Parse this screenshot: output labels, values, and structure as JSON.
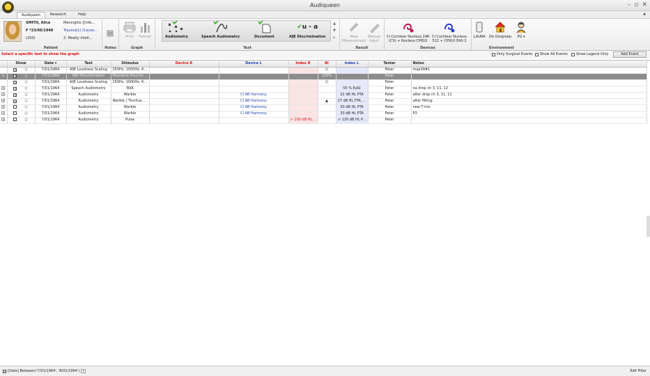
{
  "window": {
    "title": "Audiqueen"
  },
  "menu": {
    "tabs": [
      "Audiqueen",
      "Research",
      "Help"
    ]
  },
  "patient": {
    "name": "SMITH, Alice",
    "dob": "F *23/06/1948",
    "id": "(250)",
    "diag1": "Meningitis ([Infe...",
    "diag2": "Trauma(L) (Cause...",
    "diag3": "2: Mostly Intell...",
    "group_label": "Patient"
  },
  "notes": {
    "group_label": "Notes"
  },
  "graph": {
    "print": "Print",
    "format": "Format",
    "group_label": "Graph"
  },
  "test": {
    "group_label": "Text",
    "buttons": [
      "Audiometry",
      "Speech Audiometry",
      "Document",
      "A§E Discrimination"
    ],
    "glyph_ua": "u - a"
  },
  "result": {
    "new": "New",
    "measurement": "Measurement",
    "manual": "Manual",
    "input": "Input",
    "group_label": "Result"
  },
  "devices": {
    "group_label": "Devices",
    "dev1_line1": "CI Cochlear Nucleus 24R",
    "dev1_line2": "(CS) + Nucleus CP810",
    "dev2_line1": "CI Cochlear Nucleus",
    "dev2_line2": "512 + CP910 EAS 2"
  },
  "environment": {
    "group_label": "Environment",
    "items": [
      "LAURA",
      "De Oorgroep",
      "PG"
    ]
  },
  "hint": "Select a specific test to show the graph",
  "options": {
    "only_surgical": "Only Surgical Events",
    "show_all": "Show All Events",
    "legend_only": "Show Legend Only",
    "add_event": "Add Event"
  },
  "grid": {
    "headers": [
      "Show",
      "Date",
      "Test",
      "Stimulus",
      "Device R",
      "Device L",
      "Index R",
      "Bi",
      "Index L",
      "Tester",
      "Notes"
    ],
    "rows": [
      {
        "exp": "",
        "show": true,
        "date": "7/01/1964",
        "test": "A§E Loudness Scaling",
        "stimulus": "250Hz, 1000Hz, 40...",
        "devR": "",
        "devL": "",
        "idxR": "",
        "bi": "()",
        "idxL": "",
        "tester": "Peter",
        "notes": "map39#1",
        "selected": false
      },
      {
        "exp": "▸",
        "show": true,
        "date": "7/01/1964",
        "test": "A§E Discrimination",
        "stimulus": "Phoneme Discrimin...",
        "devR": "",
        "devL": "",
        "idxR": "",
        "bi": "100%",
        "idxL": "",
        "tester": "Peter",
        "notes": "",
        "selected": true
      },
      {
        "exp": "",
        "show": true,
        "date": "7/01/1964",
        "test": "A§E Loudness Scaling",
        "stimulus": "250Hz, 1000Hz, 40...",
        "devR": "",
        "devL": "",
        "idxR": "",
        "bi": "()",
        "idxL": "",
        "tester": "Peter",
        "notes": "",
        "selected": false
      },
      {
        "exp": "+",
        "show": true,
        "date": "7/01/1964",
        "test": "Speech Audiometry",
        "stimulus": "NVA",
        "devR": "",
        "devL": "",
        "idxR": "",
        "bi": "",
        "idxL": "55 % EaSI",
        "tester": "Peter",
        "notes": "na drop ch 3, 11, 12",
        "selected": false
      },
      {
        "exp": "+",
        "show": true,
        "date": "7/01/1964",
        "test": "Audiometry",
        "stimulus": "Warble",
        "devR": "",
        "devL": "CI AB Harmony",
        "idxR": "",
        "bi": "",
        "idxL": "22 dB HL PTA",
        "tester": "Peter",
        "notes": "after drop ch 3, 11, 12",
        "selected": false
      },
      {
        "exp": "+",
        "show": true,
        "date": "7/01/1964",
        "test": "Audiometry",
        "stimulus": "Warble | Tinnitus | ...",
        "devR": "",
        "devL": "CI AB Harmony",
        "idxR": "",
        "bi": "▲",
        "idxL": "27 dB HL PTA | +",
        "tester": "Peter",
        "notes": "after fitting",
        "selected": false
      },
      {
        "exp": "+",
        "show": false,
        "date": "7/01/1964",
        "test": "Audiometry",
        "stimulus": "Warble",
        "devR": "",
        "devL": "CI AB Harmony",
        "idxR": "",
        "bi": "",
        "idxL": "30 dB HL PTA",
        "tester": "Peter",
        "notes": "new T-mic",
        "selected": false
      },
      {
        "exp": "+",
        "show": false,
        "date": "7/01/1964",
        "test": "Audiometry",
        "stimulus": "Warble",
        "devR": "",
        "devL": "CI AB Harmony",
        "idxR": "",
        "bi": "",
        "idxL": "33 dB HL PTA",
        "tester": "Peter",
        "notes": "P3",
        "selected": false
      },
      {
        "exp": "+",
        "show": false,
        "date": "7/01/1964",
        "test": "Audiometry",
        "stimulus": "Pulse",
        "devR": "",
        "devL": "",
        "idxR": "> 100 dB HL P...",
        "bi": "",
        "idxL": "> 120 dB HL P...",
        "tester": "Peter",
        "notes": "",
        "selected": false
      }
    ]
  },
  "filter": {
    "text": "[Date] Between('7/01/1964', '8/01/1964')",
    "edit": "Edit Filter"
  }
}
